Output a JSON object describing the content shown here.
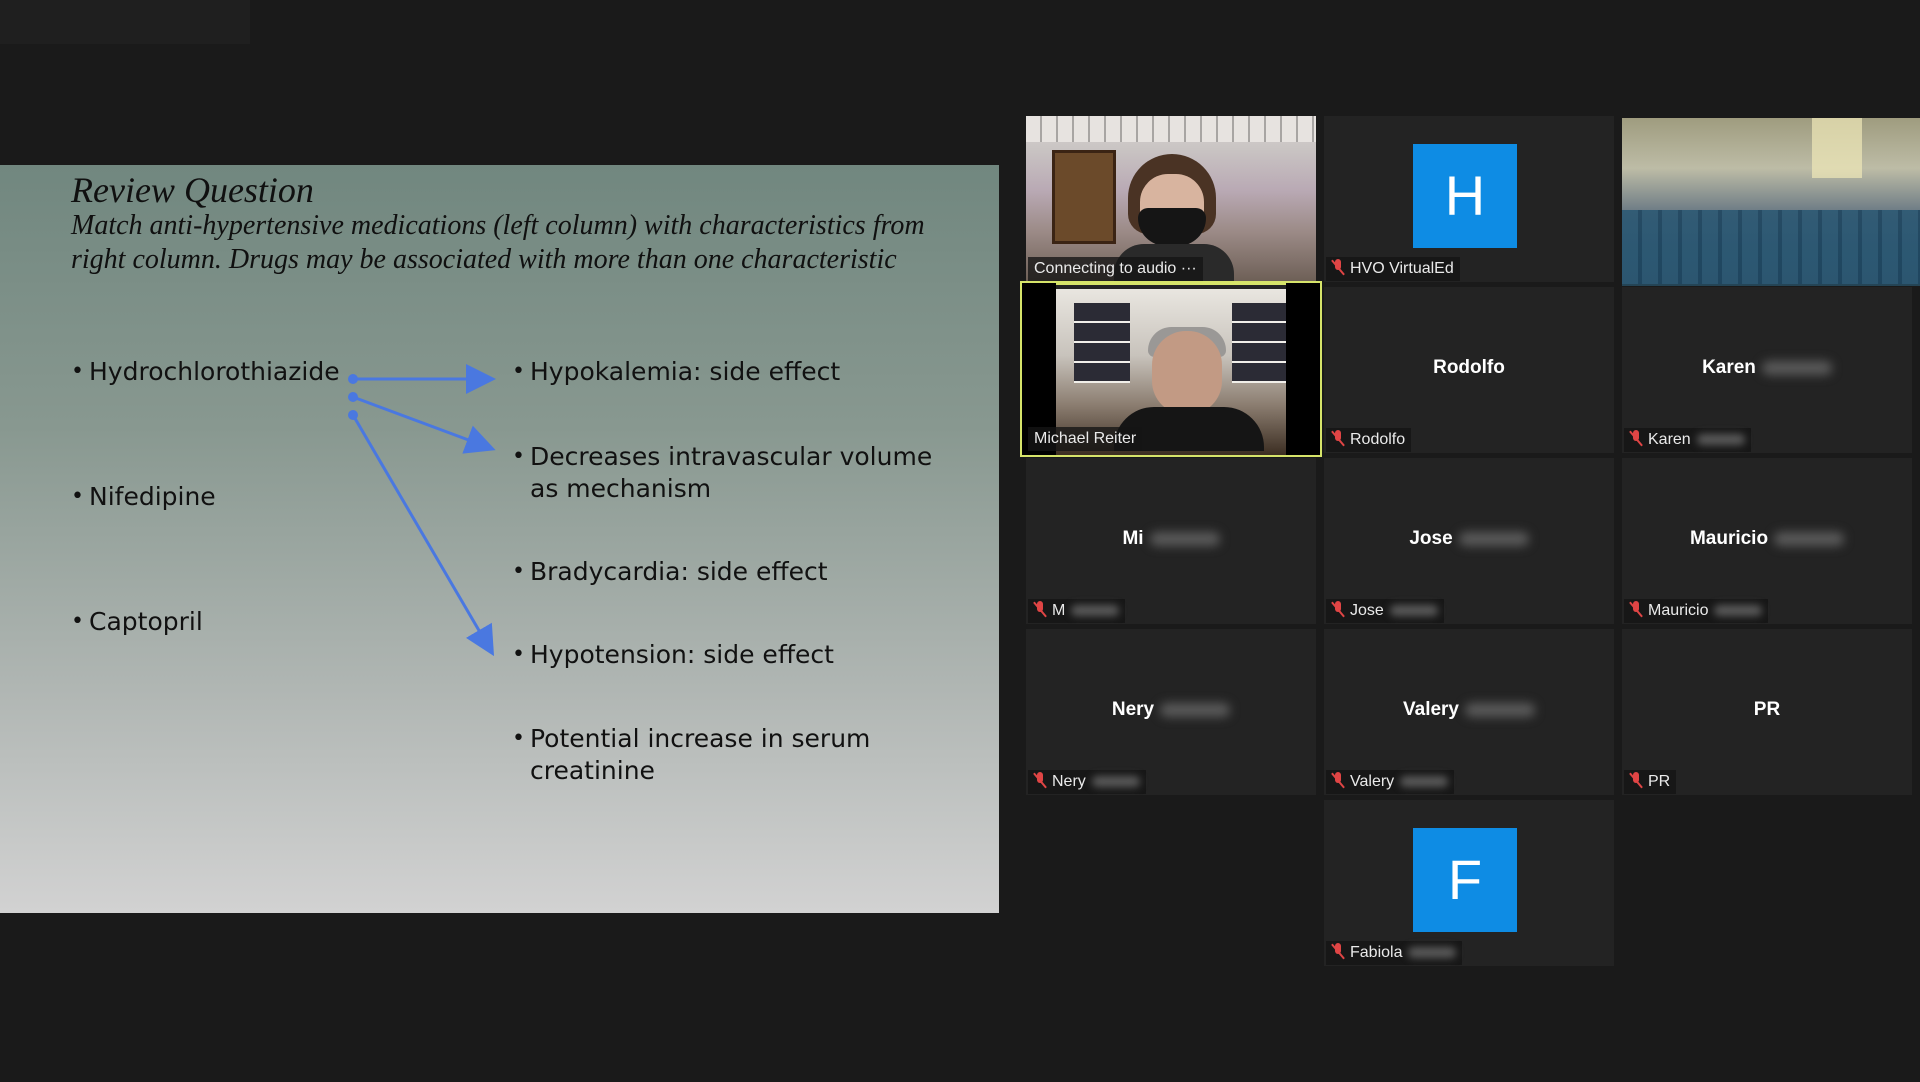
{
  "slide": {
    "title": "Review Question",
    "subtitle": "Match anti-hypertensive medications (left column) with characteristics from right column. Drugs may be associated with more than one characteristic",
    "left_items": [
      "Hydrochlorothiazide",
      "Nifedipine",
      "Captopril"
    ],
    "right_items": [
      "Hypokalemia: side effect",
      "Decreases intravascular volume as mechanism",
      "Bradycardia: side effect",
      "Hypotension: side effect",
      "Potential increase in  serum creatinine"
    ],
    "arrow_color": "#4a78e0"
  },
  "participants": {
    "connecting": {
      "label": "Connecting to audio ···"
    },
    "hvo": {
      "avatar_letter": "H",
      "label": "HVO VirtualEd"
    },
    "michael": {
      "label": "Michael Reiter"
    },
    "rodolfo": {
      "center": "Rodolfo",
      "label": "Rodolfo"
    },
    "karen": {
      "center": "Karen",
      "label": "Karen"
    },
    "mi": {
      "center": "Mi",
      "label": "M"
    },
    "jose": {
      "center": "Jose",
      "label": "Jose"
    },
    "mauricio": {
      "center": "Mauricio",
      "label": "Mauricio"
    },
    "nery": {
      "center": "Nery",
      "label": "Nery"
    },
    "valery": {
      "center": "Valery",
      "label": "Valery"
    },
    "pr": {
      "center": "PR",
      "label": "PR"
    },
    "fabiola": {
      "avatar_letter": "F",
      "label": "Fabiola"
    }
  },
  "colors": {
    "active_speaker_border": "#d6e46a",
    "avatar_bg": "#0e8ce4",
    "muted_icon": "#e04545"
  }
}
